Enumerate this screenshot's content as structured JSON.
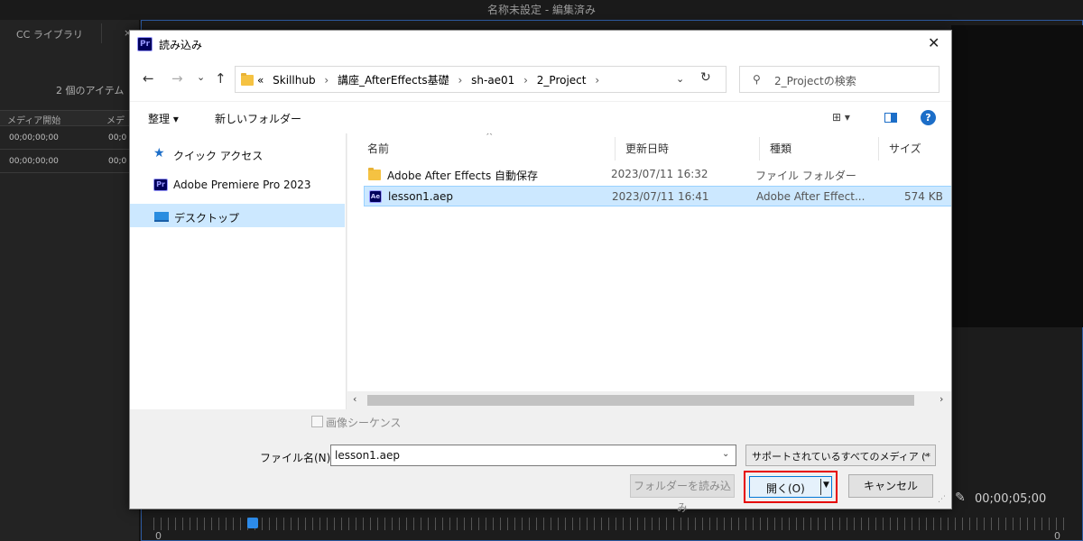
{
  "background": {
    "window_title": "名称未設定 - 編集済み",
    "library_tab": "CC ライブラリ",
    "close_char": "×",
    "item_count": "2 個のアイテム",
    "columns": [
      "メディア開始",
      "メデ"
    ],
    "rows": [
      [
        "00;00;00;00",
        "00;0"
      ],
      [
        "00;00;00;00",
        "00;0"
      ]
    ],
    "timecode": "00;00;05;00",
    "ruler_start": "0",
    "ruler_end": "0"
  },
  "dialog": {
    "app_badge": "Pr",
    "title": "読み込み",
    "close": "✕",
    "nav": {
      "back": "←",
      "forward": "→",
      "recent": "⌄",
      "up": "↑"
    },
    "breadcrumbs": [
      "«",
      "Skillhub",
      "›",
      "講座_AfterEffects基礎",
      "›",
      "sh-ae01",
      "›",
      "2_Project",
      "›"
    ],
    "address_dropdown": "⌄",
    "refresh": "↻",
    "search_placeholder": "2_Projectの検索",
    "toolbar": {
      "organize": "整理 ▾",
      "new_folder": "新しいフォルダー",
      "view": "⊞ ▾",
      "help": "?"
    },
    "sidebar": [
      {
        "label": "クイック アクセス",
        "icon": "star-icon"
      },
      {
        "label": "Adobe Premiere Pro 2023",
        "icon": "premiere-icon",
        "badge": "Pr"
      },
      {
        "label": "デスクトップ",
        "icon": "desktop-icon",
        "selected": true
      }
    ],
    "columns": {
      "name": "名前",
      "date": "更新日時",
      "type": "種類",
      "size": "サイズ",
      "sort": "^"
    },
    "files": [
      {
        "name": "Adobe After Effects 自動保存",
        "date": "2023/07/11 16:32",
        "type": "ファイル フォルダー",
        "size": "",
        "icon": "folder-icon"
      },
      {
        "name": "lesson1.aep",
        "date": "2023/07/11 16:41",
        "type": "Adobe After Effect...",
        "size": "574 KB",
        "icon": "ae-file-icon",
        "badge": "Ae",
        "selected": true
      }
    ],
    "scroll": {
      "left": "‹",
      "right": "›"
    },
    "image_sequence_label": "画像シーケンス",
    "filename_label": "ファイル名(N):",
    "filename_value": "lesson1.aep",
    "filename_drop": "⌄",
    "filter": "サポートされているすべてのメディア (*",
    "filter_drop": "⌄",
    "import_folder_button": "フォルダーを読み込み",
    "open_button": "開く(O)",
    "open_arrow": "▼",
    "cancel_button": "キャンセル"
  }
}
